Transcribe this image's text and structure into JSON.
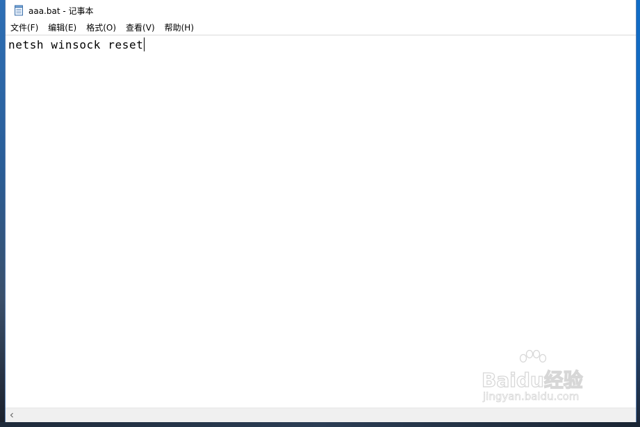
{
  "window": {
    "title": "aaa.bat - 记事本"
  },
  "menu": {
    "items": [
      {
        "label": "文件(F)"
      },
      {
        "label": "编辑(E)"
      },
      {
        "label": "格式(O)"
      },
      {
        "label": "查看(V)"
      },
      {
        "label": "帮助(H)"
      }
    ]
  },
  "editor": {
    "content": "netsh winsock reset"
  },
  "watermark": {
    "brand": "Baidu经验",
    "url": "jingyan.baidu.com"
  },
  "icons": {
    "app": "notepad-icon",
    "scroll_left": "chevron-left-icon"
  },
  "colors": {
    "window_bg": "#ffffff",
    "text": "#000000",
    "scrollbar": "#f0f0f0"
  }
}
